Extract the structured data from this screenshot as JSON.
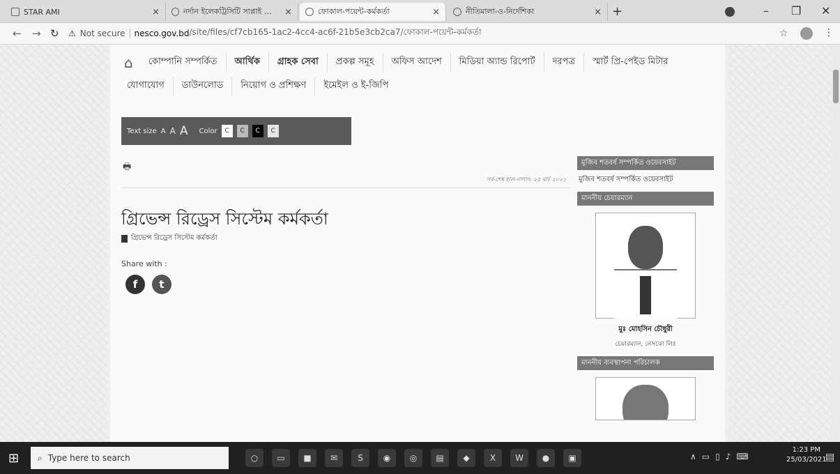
{
  "browser": {
    "tabs": [
      {
        "label": "STAR AMI"
      },
      {
        "label": "নর্দান ইলেকট্রিসিটি সাপ্লাই কোম্পানি"
      },
      {
        "label": "ফোকাল-পয়েন্ট-কর্মকর্তা"
      },
      {
        "label": "নীতিমালা-ও-নির্দেশিকা"
      }
    ],
    "new_tab": "+",
    "window_controls": {
      "minimize": "–",
      "maximize": "❐",
      "close": "✕"
    },
    "not_secure": "Not secure",
    "url_host": "nesco.gov.bd",
    "url_path": "/site/files/cf7cb165-1ac2-4cc4-ac6f-21b5e3cb2ca7/ফোকাল-পয়েন্ট-কর্মকর্তা"
  },
  "menu": {
    "row1": [
      "কোম্পানি সম্পর্কিত",
      "আর্থিক",
      "গ্রাহক সেবা",
      "প্রকল্প সমূহ",
      "অফিস আদেশ",
      "মিডিয়া অ্যান্ড রিপোর্ট",
      "দরপত্র",
      "স্মার্ট প্রি-পেইড মিটার"
    ],
    "row2": [
      "যোগাযোগ",
      "ডাউনলোড",
      "নিয়োগ ও প্রশিক্ষণ",
      "ইমেইল ও ই-জিপি"
    ]
  },
  "accessibility": {
    "text_size_label": "Text size",
    "a_small": "A",
    "a_mid": "A",
    "a_big": "A",
    "color_label": "Color",
    "swatches": [
      "C",
      "C",
      "C",
      "C"
    ]
  },
  "article": {
    "updated": "সর্ব-শেষ হাল-নাগাদ: ২৫ মার্চ ২০২১",
    "title": "গ্রিভেন্স রিড্রেস সিস্টেম কর্মকর্তা",
    "doc_link": "গ্রিভেন্স রিড্রেস সিস্টেম কর্মকর্তা",
    "share_label": "Share with :"
  },
  "sidebar": {
    "head1": "মুজিব শতবর্ষ সম্পর্কিত ওয়েবসাইট",
    "link1": "মুজিব শতবর্ষ সম্পর্কিত ওয়েবসাইট",
    "head2": "মাননীয় চেয়ারম্যান",
    "name": "মুঃ মোহসিন চৌধুরী",
    "subname": "চেয়ারম্যান, নেসকো লিঃ",
    "head3": "মাননীয় ব্যবস্থাপনা পরিচালক"
  },
  "taskbar": {
    "search_placeholder": "Type here to search",
    "time": "1:23 PM",
    "date": "25/03/2021"
  }
}
